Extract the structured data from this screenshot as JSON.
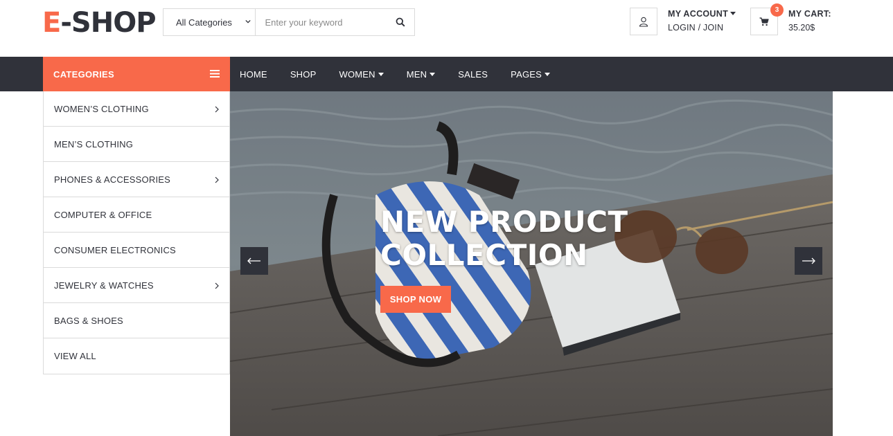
{
  "logo": {
    "accent": "E",
    "rest": "-SHOP"
  },
  "search": {
    "category_selected": "All Categories",
    "placeholder": "Enter your keyword"
  },
  "account": {
    "title": "MY ACCOUNT",
    "link": "LOGIN / JOIN"
  },
  "cart": {
    "title": "MY CART:",
    "total": "35.20$",
    "count": "3"
  },
  "sidebar": {
    "heading": "CATEGORIES",
    "items": [
      {
        "label": "WOMEN’S CLOTHING",
        "has_submenu": true
      },
      {
        "label": "MEN’S CLOTHING",
        "has_submenu": false
      },
      {
        "label": "PHONES & ACCESSORIES",
        "has_submenu": true
      },
      {
        "label": "COMPUTER & OFFICE",
        "has_submenu": false
      },
      {
        "label": "CONSUMER ELECTRONICS",
        "has_submenu": false
      },
      {
        "label": "JEWELRY & WATCHES",
        "has_submenu": true
      },
      {
        "label": "BAGS & SHOES",
        "has_submenu": false
      },
      {
        "label": "VIEW ALL",
        "has_submenu": false
      }
    ]
  },
  "nav": {
    "items": [
      {
        "label": "HOME",
        "dropdown": false
      },
      {
        "label": "SHOP",
        "dropdown": false
      },
      {
        "label": "WOMEN",
        "dropdown": true
      },
      {
        "label": "MEN",
        "dropdown": true
      },
      {
        "label": "SALES",
        "dropdown": false
      },
      {
        "label": "PAGES",
        "dropdown": true
      }
    ]
  },
  "hero": {
    "title_line1": "NEW PRODUCT",
    "title_line2": "COLLECTION",
    "cta": "SHOP NOW"
  },
  "colors": {
    "accent": "#f8694a",
    "dark": "#30323a",
    "border": "#dadada"
  },
  "icons": {
    "search": "search-icon",
    "user": "user-icon",
    "cart": "cart-icon",
    "menu": "hamburger-icon",
    "prev": "arrow-left-icon",
    "next": "arrow-right-icon"
  }
}
